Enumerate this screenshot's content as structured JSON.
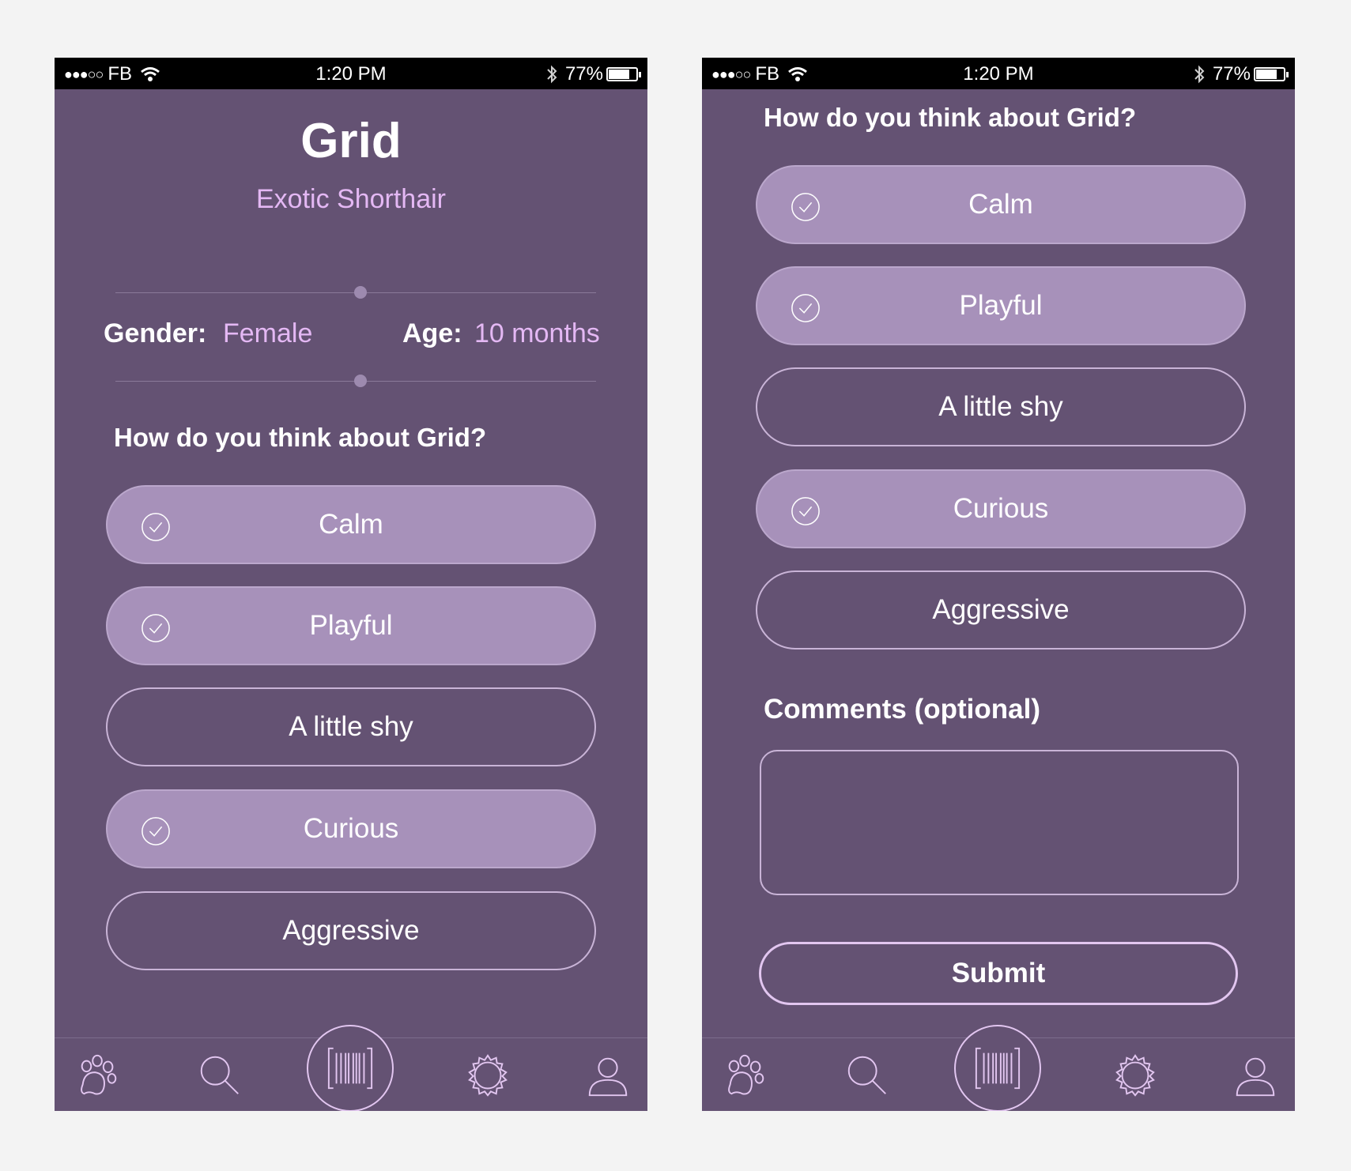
{
  "status_bar": {
    "signal": "●●●○○",
    "carrier": "FB",
    "time": "1:20 PM",
    "battery": "77%",
    "battery_level": 0.77
  },
  "profile": {
    "name": "Grid",
    "breed": "Exotic Shorthair",
    "gender_label": "Gender:",
    "gender_value": "Female",
    "age_label": "Age:",
    "age_value": "10 months"
  },
  "question": "How do you think about Grid?",
  "options": [
    {
      "label": "Calm",
      "selected": true
    },
    {
      "label": "Playful",
      "selected": true
    },
    {
      "label": "A little shy",
      "selected": false
    },
    {
      "label": "Curious",
      "selected": true
    },
    {
      "label": "Aggressive",
      "selected": false
    }
  ],
  "comments": {
    "label": "Comments (optional)",
    "value": ""
  },
  "submit_label": "Submit",
  "tabs": [
    "paw-icon",
    "search-icon",
    "barcode-scan-icon",
    "settings-icon",
    "profile-icon"
  ],
  "colors": {
    "background": "#645273",
    "selected_option": "#a791ba",
    "accent_text": "#e4b8f4"
  }
}
